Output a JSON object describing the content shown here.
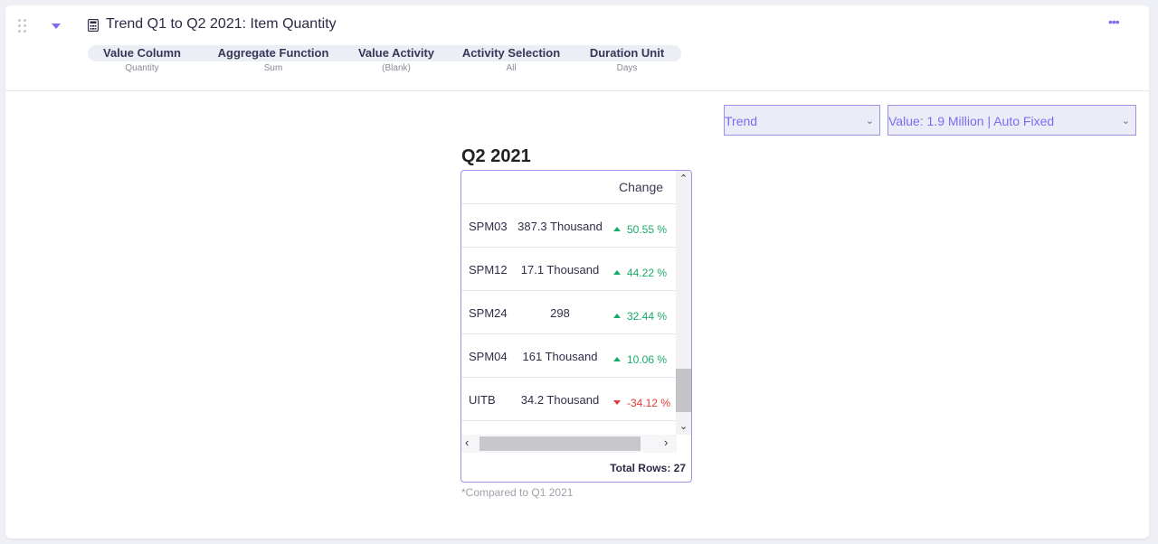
{
  "header": {
    "title": "Trend Q1 to Q2 2021: Item Quantity",
    "more_label": "•••",
    "params": [
      {
        "label": "Value Column",
        "value": "Quantity"
      },
      {
        "label": "Aggregate Function",
        "value": "Sum"
      },
      {
        "label": "Value Activity",
        "value": "(Blank)"
      },
      {
        "label": "Activity Selection",
        "value": "All"
      },
      {
        "label": "Duration Unit",
        "value": "Days"
      }
    ]
  },
  "controls": {
    "view_select": "Trend",
    "value_select": "Value: 1.9 Million | Auto Fixed"
  },
  "table": {
    "period": "Q2 2021",
    "change_header": "Change",
    "rows": [
      {
        "item": "SPM03",
        "value": "387.3 Thousand",
        "change": "50.55 %",
        "direction": "up"
      },
      {
        "item": "SPM12",
        "value": "17.1 Thousand",
        "change": "44.22 %",
        "direction": "up"
      },
      {
        "item": "SPM24",
        "value": "298",
        "change": "32.44 %",
        "direction": "up"
      },
      {
        "item": "SPM04",
        "value": "161 Thousand",
        "change": "10.06 %",
        "direction": "up"
      },
      {
        "item": "UITB",
        "value": "34.2 Thousand",
        "change": "-34.12 %",
        "direction": "down"
      }
    ],
    "total_rows": "Total Rows: 27",
    "footnote": "*Compared to Q1 2021"
  },
  "icons": {
    "drag": "drag-handle-icon",
    "collapse": "caret-down-icon",
    "calculator": "calculator-icon",
    "more": "more-horizontal-icon",
    "chevron": "chevron-down-icon"
  },
  "colors": {
    "accent": "#7b6cf0",
    "positive": "#1aaa6a",
    "negative": "#e23a3a"
  }
}
